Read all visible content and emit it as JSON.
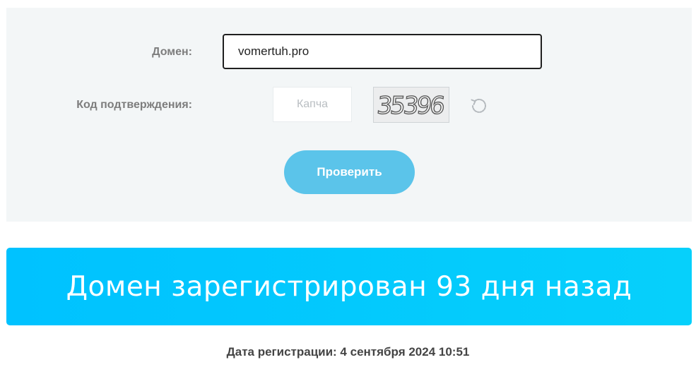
{
  "form": {
    "domain_label": "Домен:",
    "domain_value": "vomertuh.pro",
    "code_label": "Код подтверждения:",
    "captcha_placeholder": "Капча",
    "captcha_text": "35396",
    "submit_label": "Проверить"
  },
  "result": {
    "message": "Домен зарегистрирован 93 дня назад",
    "registration_date": "Дата регистрации: 4 сентября 2024 10:51"
  },
  "colors": {
    "panel_background": "#f3f6f7",
    "button": "#5bc4ea",
    "banner_start": "#00c2ff",
    "banner_end": "#06d0fb",
    "label": "#7d7d7d"
  },
  "icons": {
    "refresh": "refresh-icon"
  }
}
